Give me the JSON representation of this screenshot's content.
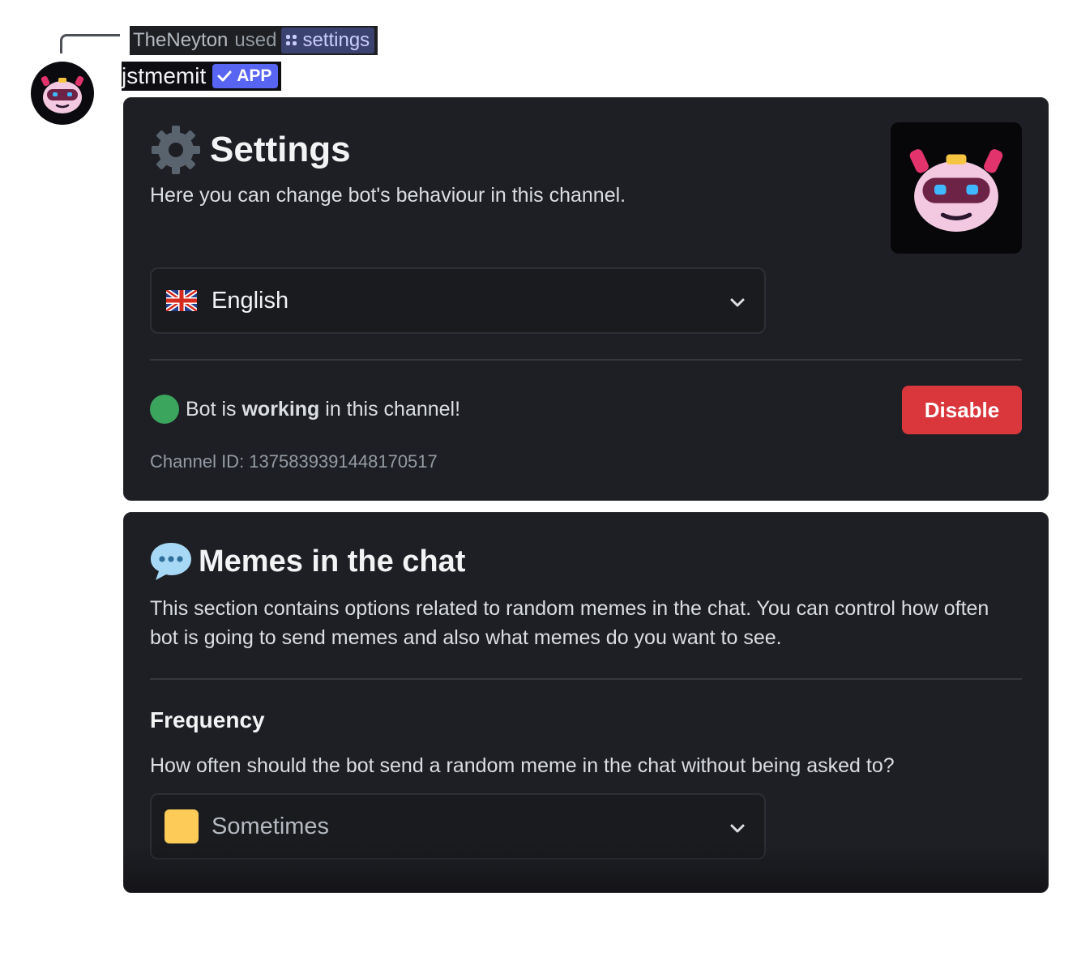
{
  "reply": {
    "user": "TheNeyton",
    "used_text": "used",
    "command": "settings"
  },
  "author": {
    "name": "jstmemit",
    "badge": "APP"
  },
  "settings_card": {
    "title": "Settings",
    "description": "Here you can change bot's behaviour in this channel.",
    "language_select": {
      "flag_icon": "uk-flag-icon",
      "selected": "English"
    },
    "status_prefix": "Bot is",
    "status_bold": "working",
    "status_suffix": "in this channel!",
    "disable_label": "Disable",
    "channel_id": "Channel ID: 1375839391448170517"
  },
  "memes_card": {
    "title": "Memes in the chat",
    "description_line1": "This section contains options related to random memes in the chat. You can control how often",
    "description_line2": "bot is going to send memes and also what memes do you want to see.",
    "frequency_heading": "Frequency",
    "frequency_question": "How often should the bot send a random meme in the chat without being asked to?",
    "frequency_select": {
      "icon": "yellow-square-icon",
      "selected": "Sometimes"
    }
  },
  "colors": {
    "card_bg": "#1e1f24",
    "accent": "#5865f2",
    "danger": "#da373c",
    "status_green": "#3ba55d"
  }
}
